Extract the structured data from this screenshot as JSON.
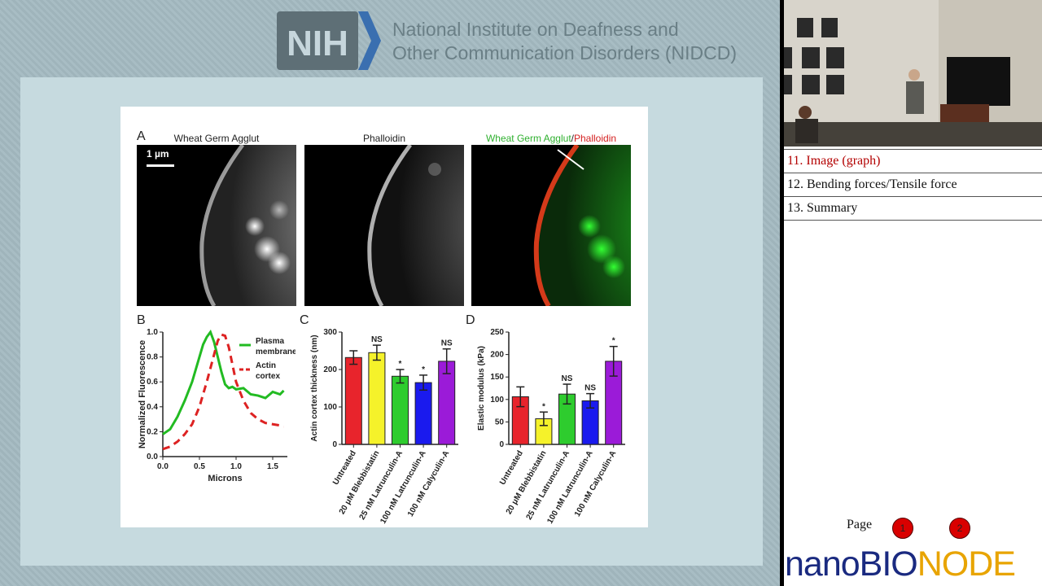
{
  "header": {
    "logo_text": "NIH",
    "org_line1": "National Institute on Deafness and",
    "org_line2": "Other Communication Disorders (NIDCD)"
  },
  "figure": {
    "panel_a": {
      "letter": "A",
      "titles": [
        "Wheat Germ Agglut",
        "Phalloidin"
      ],
      "merged_title_green": "Wheat Germ Agglut",
      "merged_title_sep": "/",
      "merged_title_red": "Phalloidin",
      "scale_bar": "1 µm"
    },
    "panel_b": {
      "letter": "B"
    },
    "panel_c": {
      "letter": "C"
    },
    "panel_d": {
      "letter": "D"
    }
  },
  "chart_data": [
    {
      "type": "line",
      "panel": "B",
      "xlabel": "Microns",
      "ylabel": "Normalized Fluorescence",
      "xlim": [
        0.0,
        1.7
      ],
      "ylim": [
        0.0,
        1.0
      ],
      "xticks": [
        "0.0",
        "0.5",
        "1.0",
        "1.5"
      ],
      "yticks": [
        "0.0",
        "0.2",
        "0.4",
        "0.6",
        "0.8",
        "1.0"
      ],
      "legend_placement": "top-right",
      "series": [
        {
          "name": "Plasma membrane",
          "color": "#22bb22",
          "style": "solid",
          "x": [
            0.0,
            0.1,
            0.2,
            0.3,
            0.4,
            0.5,
            0.55,
            0.6,
            0.65,
            0.7,
            0.75,
            0.8,
            0.85,
            0.9,
            0.95,
            1.0,
            1.1,
            1.2,
            1.3,
            1.4,
            1.5,
            1.6,
            1.65
          ],
          "y": [
            0.18,
            0.22,
            0.32,
            0.45,
            0.6,
            0.8,
            0.9,
            0.96,
            1.0,
            0.92,
            0.8,
            0.68,
            0.58,
            0.55,
            0.56,
            0.54,
            0.55,
            0.5,
            0.49,
            0.47,
            0.52,
            0.5,
            0.53
          ]
        },
        {
          "name": "Actin cortex",
          "color": "#dd2222",
          "style": "dashed",
          "x": [
            0.0,
            0.1,
            0.2,
            0.3,
            0.4,
            0.5,
            0.6,
            0.7,
            0.75,
            0.8,
            0.85,
            0.9,
            0.95,
            1.0,
            1.1,
            1.2,
            1.3,
            1.4,
            1.5,
            1.6,
            1.65
          ],
          "y": [
            0.06,
            0.08,
            0.12,
            0.18,
            0.26,
            0.4,
            0.6,
            0.82,
            0.93,
            0.98,
            0.97,
            0.88,
            0.74,
            0.6,
            0.45,
            0.35,
            0.3,
            0.27,
            0.26,
            0.25,
            0.24
          ]
        }
      ]
    },
    {
      "type": "bar",
      "panel": "C",
      "ylabel": "Actin cortex thickness (nm)",
      "ylim": [
        0,
        300
      ],
      "yticks": [
        "0",
        "100",
        "200",
        "300"
      ],
      "categories": [
        "Untreated",
        "20 μM Blebbistatin",
        "25 nM Latrunculin-A",
        "100 nM Latrunculin-A",
        "100 nM Calyculin-A"
      ],
      "values": [
        232,
        245,
        182,
        165,
        222
      ],
      "errors": [
        18,
        20,
        18,
        20,
        33
      ],
      "significance": [
        "",
        "NS",
        "*",
        "*",
        "NS"
      ],
      "colors": [
        "#e8242c",
        "#f5f22a",
        "#2ecc2e",
        "#1a1aee",
        "#9b1bd8"
      ]
    },
    {
      "type": "bar",
      "panel": "D",
      "ylabel": "Elastic modulus (kPa)",
      "ylim": [
        0,
        250
      ],
      "yticks": [
        "0",
        "50",
        "100",
        "150",
        "200",
        "250"
      ],
      "categories": [
        "Untreated",
        "20 μM Blebbistatin",
        "25 nM Latrunculin-A",
        "100 nM Latrunculin-A",
        "100 nM Calyculin-A"
      ],
      "values": [
        106,
        57,
        112,
        97,
        185
      ],
      "errors": [
        22,
        15,
        22,
        16,
        33
      ],
      "significance": [
        "",
        "*",
        "NS",
        "NS",
        "*"
      ],
      "colors": [
        "#e8242c",
        "#f5f22a",
        "#2ecc2e",
        "#1a1aee",
        "#9b1bd8"
      ]
    }
  ],
  "sidebar": {
    "chapters": [
      {
        "label": "11. Image (graph)",
        "active": true
      },
      {
        "label": "12. Bending forces/Tensile force",
        "active": false
      },
      {
        "label": "13. Summary",
        "active": false
      }
    ],
    "pager_label": "Page",
    "pages": [
      "1",
      "2"
    ],
    "brand_nano": "nano",
    "brand_bio": "BIO",
    "brand_node": "NODE"
  }
}
